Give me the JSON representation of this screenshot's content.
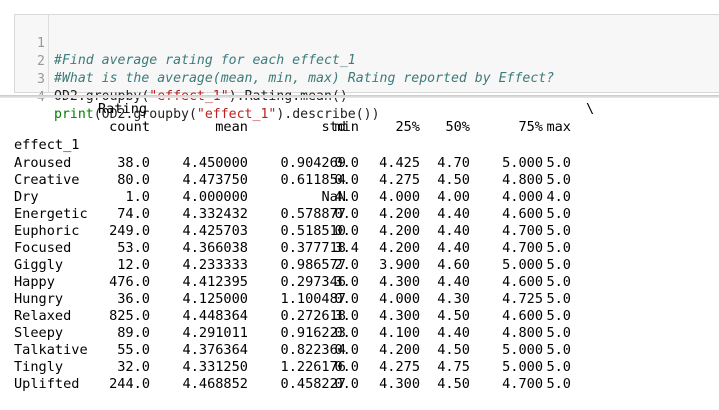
{
  "code_cell": {
    "lines": [
      {
        "num": "1",
        "text": "#Find average rating for each effect_1"
      },
      {
        "num": "2",
        "text": "#What is the average(mean, min, max) Rating reported by Effect?"
      },
      {
        "num": "3",
        "pre": "OD2.groupby(",
        "str": "\"effect_1\"",
        "post": ").Rating.mean()"
      },
      {
        "num": "4",
        "builtin": "print",
        "pre": "(OD2.groupby(",
        "str": "\"effect_1\"",
        "post": ").describe())"
      }
    ]
  },
  "output": {
    "top_header": "Rating",
    "continuation": "\\",
    "columns": [
      "count",
      "mean",
      "std",
      "min",
      "25%",
      "50%",
      "75%",
      "max"
    ],
    "index_name": "effect_1",
    "rows": [
      {
        "label": "Aroused",
        "values": [
          "38.0",
          "4.450000",
          "0.904269",
          "0.0",
          "4.425",
          "4.70",
          "5.000",
          "5.0"
        ]
      },
      {
        "label": "Creative",
        "values": [
          "80.0",
          "4.473750",
          "0.611854",
          "0.0",
          "4.275",
          "4.50",
          "4.800",
          "5.0"
        ]
      },
      {
        "label": "Dry",
        "values": [
          "1.0",
          "4.000000",
          "NaN",
          "4.0",
          "4.000",
          "4.00",
          "4.000",
          "4.0"
        ]
      },
      {
        "label": "Energetic",
        "values": [
          "74.0",
          "4.332432",
          "0.578877",
          "0.0",
          "4.200",
          "4.40",
          "4.600",
          "5.0"
        ]
      },
      {
        "label": "Euphoric",
        "values": [
          "249.0",
          "4.425703",
          "0.518510",
          "0.0",
          "4.200",
          "4.40",
          "4.700",
          "5.0"
        ]
      },
      {
        "label": "Focused",
        "values": [
          "53.0",
          "4.366038",
          "0.377718",
          "3.4",
          "4.200",
          "4.40",
          "4.700",
          "5.0"
        ]
      },
      {
        "label": "Giggly",
        "values": [
          "12.0",
          "4.233333",
          "0.986577",
          "2.0",
          "3.900",
          "4.60",
          "5.000",
          "5.0"
        ]
      },
      {
        "label": "Happy",
        "values": [
          "476.0",
          "4.412395",
          "0.297346",
          "3.0",
          "4.300",
          "4.40",
          "4.600",
          "5.0"
        ]
      },
      {
        "label": "Hungry",
        "values": [
          "36.0",
          "4.125000",
          "1.100487",
          "0.0",
          "4.000",
          "4.30",
          "4.725",
          "5.0"
        ]
      },
      {
        "label": "Relaxed",
        "values": [
          "825.0",
          "4.448364",
          "0.272618",
          "3.0",
          "4.300",
          "4.50",
          "4.600",
          "5.0"
        ]
      },
      {
        "label": "Sleepy",
        "values": [
          "89.0",
          "4.291011",
          "0.916223",
          "0.0",
          "4.100",
          "4.40",
          "4.800",
          "5.0"
        ]
      },
      {
        "label": "Talkative",
        "values": [
          "55.0",
          "4.376364",
          "0.822364",
          "0.0",
          "4.200",
          "4.50",
          "5.000",
          "5.0"
        ]
      },
      {
        "label": "Tingly",
        "values": [
          "32.0",
          "4.331250",
          "1.226176",
          "0.0",
          "4.275",
          "4.75",
          "5.000",
          "5.0"
        ]
      },
      {
        "label": "Uplifted",
        "values": [
          "244.0",
          "4.468852",
          "0.458227",
          "0.0",
          "4.300",
          "4.50",
          "4.700",
          "5.0"
        ]
      }
    ]
  }
}
